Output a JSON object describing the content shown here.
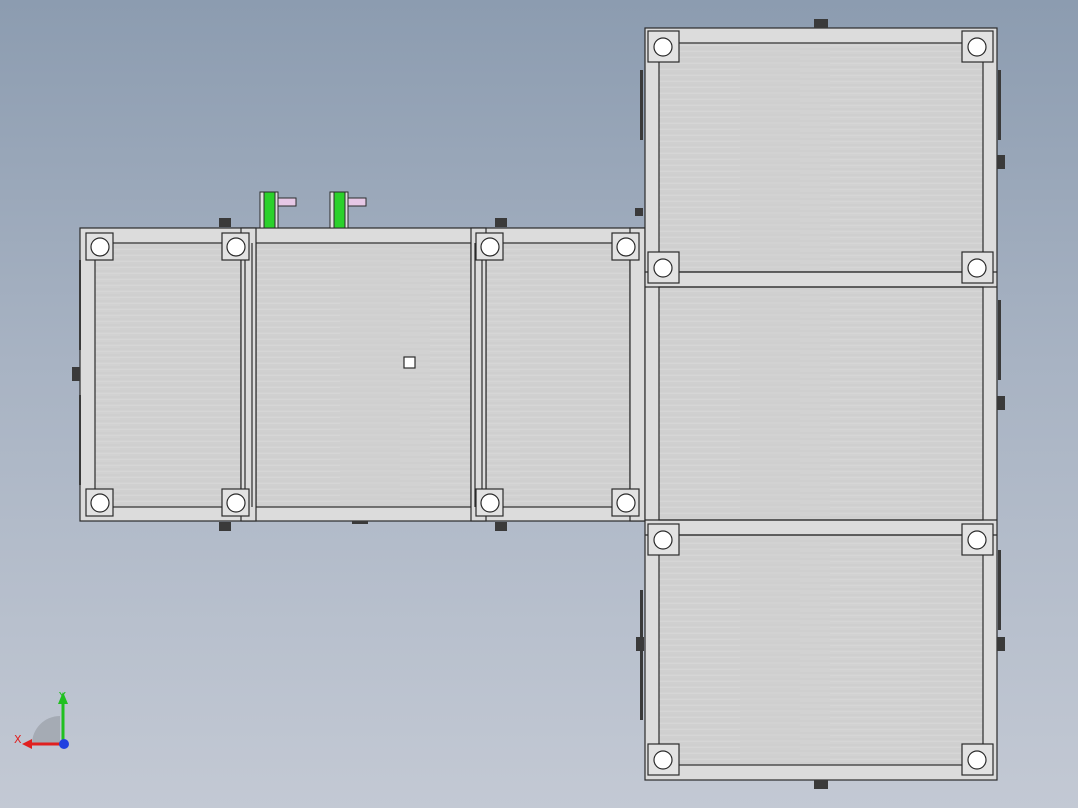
{
  "viewport": {
    "background_top": "#8c9cb0",
    "background_bottom": "#c3c9d4"
  },
  "model": {
    "panel_fill": "#d2d2d2",
    "frame_fill": "#dcdcdc",
    "edge_color": "#2b2b2b",
    "clamp_green": "#2bd12b",
    "pin_pink": "#e6c8e6"
  },
  "triad": {
    "x_label": "X",
    "y_label": "Y",
    "x_color": "#e02020",
    "y_color": "#20c020",
    "z_color": "#2040e0"
  }
}
